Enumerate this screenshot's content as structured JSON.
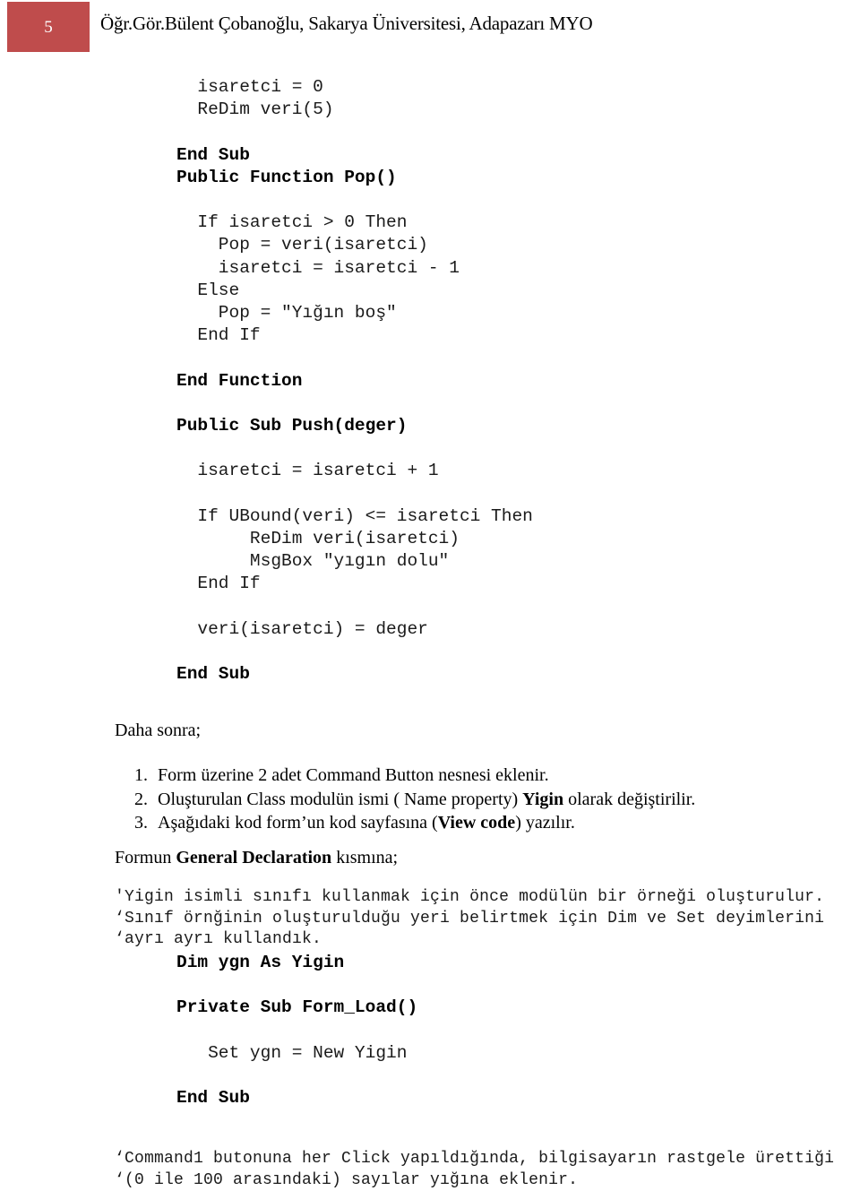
{
  "header": {
    "page_number": "5",
    "title": "Öğr.Gör.Bülent Çobanoğlu, Sakarya Üniversitesi, Adapazarı MYO",
    "accent_color": "#bf4c4c",
    "page_number_color": "#ffffff"
  },
  "class_module_code": {
    "lines": [
      {
        "text": "  isaretci = 0",
        "bold": false
      },
      {
        "text": "  ReDim veri(5)",
        "bold": false
      },
      {
        "text": "",
        "bold": false
      },
      {
        "text": "End Sub",
        "bold": true
      },
      {
        "text": "Public Function Pop()",
        "bold": true
      },
      {
        "text": "",
        "bold": false
      },
      {
        "text": "  If isaretci > 0 Then",
        "bold": false
      },
      {
        "text": "    Pop = veri(isaretci)",
        "bold": false
      },
      {
        "text": "    isaretci = isaretci - 1",
        "bold": false
      },
      {
        "text": "  Else",
        "bold": false
      },
      {
        "text": "    Pop = \"Yığın boş\"",
        "bold": false
      },
      {
        "text": "  End If",
        "bold": false
      },
      {
        "text": "",
        "bold": false
      },
      {
        "text": "End Function",
        "bold": true
      },
      {
        "text": "",
        "bold": false
      },
      {
        "text": "Public Sub Push(deger)",
        "bold": true
      },
      {
        "text": "",
        "bold": false
      },
      {
        "text": "  isaretci = isaretci + 1",
        "bold": false
      },
      {
        "text": "",
        "bold": false
      },
      {
        "text": "  If UBound(veri) <= isaretci Then",
        "bold": false
      },
      {
        "text": "       ReDim veri(isaretci)",
        "bold": false
      },
      {
        "text": "       MsgBox \"yıgın dolu\"",
        "bold": false
      },
      {
        "text": "  End If",
        "bold": false
      },
      {
        "text": "",
        "bold": false
      },
      {
        "text": "  veri(isaretci) = deger",
        "bold": false
      },
      {
        "text": "",
        "bold": false
      },
      {
        "text": "End Sub",
        "bold": true
      }
    ]
  },
  "prose": {
    "daha_sonra": "Daha sonra;",
    "steps": [
      "Form üzerine 2 adet Command Button nesnesi eklenir.",
      "Oluşturulan Class modulün ismi ( Name property) Yigin olarak değiştirilir.",
      "Aşağıdaki kod form’un kod sayfasına (View code) yazılır."
    ],
    "step2_prefix": "Oluşturulan Class modulün ismi ( Name property) ",
    "step2_bold": "Yigin",
    "step2_suffix": " olarak değiştirilir.",
    "step3_prefix": "Aşağıdaki kod form’un kod sayfasına (",
    "step3_bold": "View code",
    "step3_suffix": ") yazılır.",
    "formun_prefix": "Formun ",
    "formun_bold": "General Declaration",
    "formun_suffix": " kısmına;"
  },
  "general_declaration_comments": {
    "lines": [
      "'Yigin isimli sınıfı kullanmak için önce modülün bir örneği oluşturulur.",
      "‘Sınıf örnğinin oluşturulduğu yeri belirtmek için Dim ve Set deyimlerini",
      "‘ayrı ayrı kullandık."
    ]
  },
  "form_code": {
    "lines": [
      {
        "text": "Dim ygn As Yigin",
        "bold": true
      },
      {
        "text": "",
        "bold": false
      },
      {
        "text": "Private Sub Form_Load()",
        "bold": true
      },
      {
        "text": "",
        "bold": false
      },
      {
        "text": "   Set ygn = New Yigin",
        "bold": false
      },
      {
        "text": "",
        "bold": false
      },
      {
        "text": "End Sub",
        "bold": true
      }
    ]
  },
  "command_comments": {
    "lines": [
      "‘Command1 butonuna her Click yapıldığında, bilgisayarın rastgele ürettiği",
      "‘(0 ile 100 arasındaki) sayılar yığına eklenir."
    ]
  }
}
